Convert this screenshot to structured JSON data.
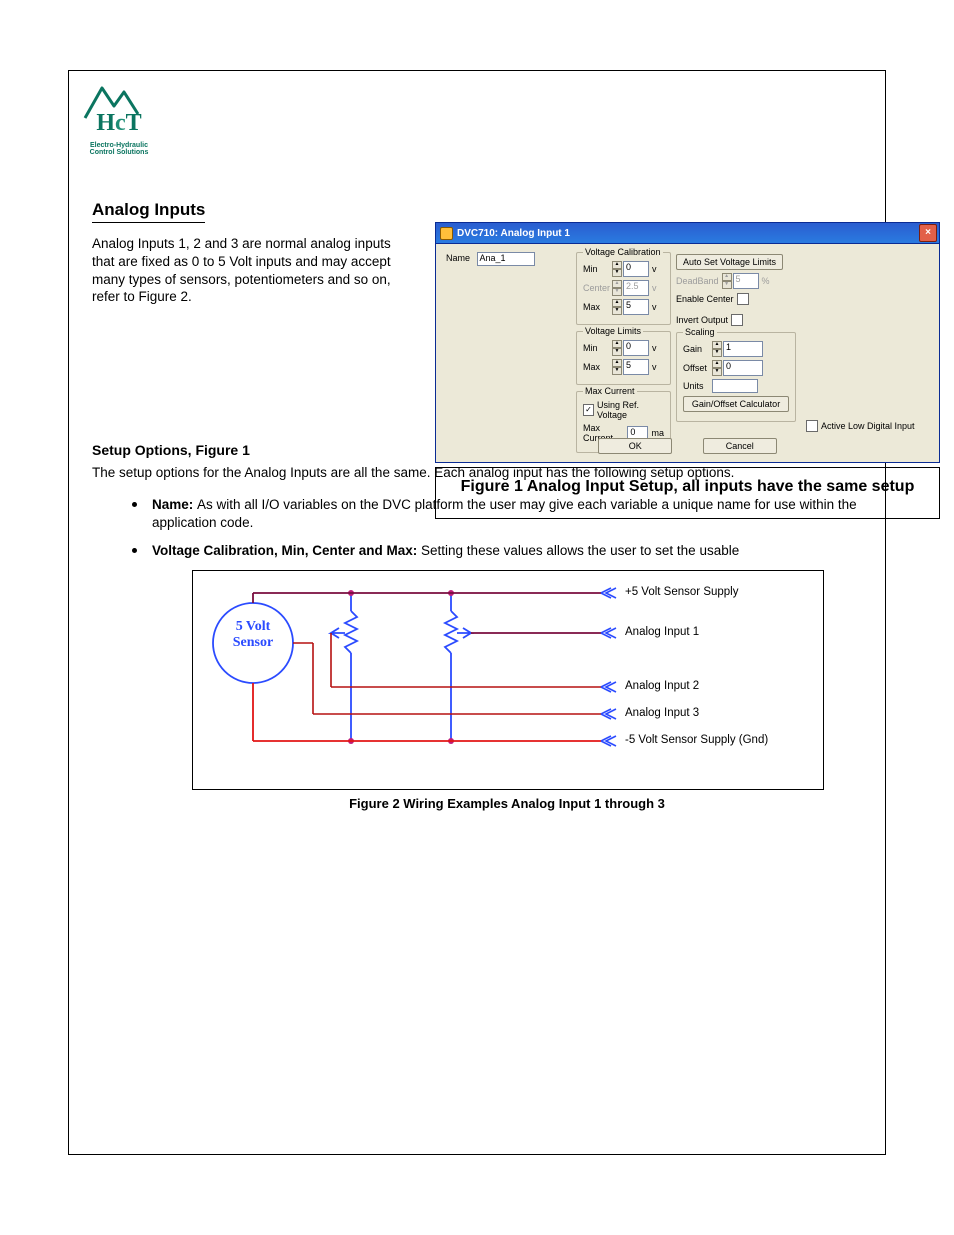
{
  "logo": {
    "line1": "Electro-Hydraulic",
    "line2": "Control Solutions"
  },
  "section_heading": "Analog Inputs",
  "intro_para": "Analog Inputs 1, 2 and 3 are normal analog inputs that are fixed as 0 to 5 Volt inputs and may accept many types of sensors, potentiometers and so on, refer to Figure 2.",
  "h_setup": "Setup Options, Figure 1",
  "para_setup": "The setup options for the Analog Inputs are all the same. Each analog input has the following setup options.",
  "bullets": {
    "b1a": "Name: ",
    "b1b": "As with all I/O variables on the DVC platform the user may give each variable a unique name for use within the application code.",
    "b2a": "Voltage Calibration, Min, Center and Max: ",
    "b2b": "Setting these values allows the user to set the usable"
  },
  "fig1_caption": "Figure 1 Analog Input Setup, all inputs have the same setup",
  "fig2_caption": "Figure 2 Wiring Examples Analog Input 1 through 3",
  "pins": {
    "ref": "+5 Volt Sensor Supply",
    "ai1": "Analog Input 1",
    "ai2": "Analog Input 2",
    "ai3": "Analog Input 3",
    "gnd": "-5 Volt Sensor Supply (Gnd)"
  },
  "sensor": {
    "l1": "5 Volt",
    "l2": "Sensor"
  },
  "dlg": {
    "title": "DVC710: Analog Input 1",
    "name_label": "Name",
    "name_value": "Ana_1",
    "grp_vcal": "Voltage Calibration",
    "min": "Min",
    "center": "Center",
    "max": "Max",
    "min_v": "0",
    "center_v": "2.5",
    "max_v": "5",
    "unit_v": "v",
    "auto_btn": "Auto Set Voltage Limits",
    "deadband": "DeadBand",
    "deadband_v": "5",
    "deadband_unit": "%",
    "enable_center": "Enable Center",
    "invert": "Invert Output",
    "grp_vlim": "Voltage Limits",
    "vlim_min": "0",
    "vlim_max": "5",
    "grp_scale": "Scaling",
    "gain": "Gain",
    "gain_v": "1",
    "offset": "Offset",
    "offset_v": "0",
    "units": "Units",
    "units_v": "",
    "calc_btn": "Gain/Offset Calculator",
    "grp_maxc": "Max Current",
    "using_ref": "Using Ref. Voltage",
    "maxc_lbl": "Max Current",
    "maxc_v": "0",
    "maxc_unit": "ma",
    "active_low": "Active Low Digital Input",
    "ok": "OK",
    "cancel": "Cancel"
  }
}
